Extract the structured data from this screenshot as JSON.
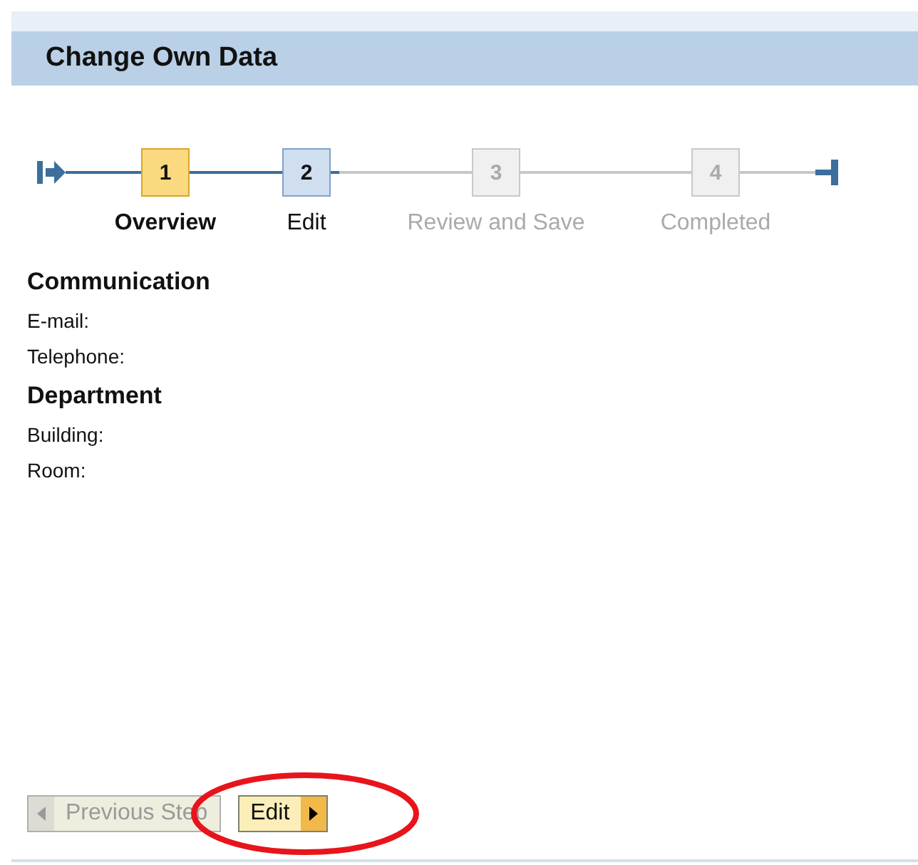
{
  "header": {
    "title": "Change Own Data"
  },
  "steps": [
    {
      "number": "1",
      "label": "Overview",
      "kind": "current"
    },
    {
      "number": "2",
      "label": "Edit",
      "kind": "active"
    },
    {
      "number": "3",
      "label": "Review and Save",
      "kind": "inactive"
    },
    {
      "number": "4",
      "label": "Completed",
      "kind": "inactive"
    }
  ],
  "sections": [
    {
      "title": "Communication",
      "fields": [
        "E-mail:",
        "Telephone:"
      ]
    },
    {
      "title": "Department",
      "fields": [
        "Building:",
        "Room:"
      ]
    }
  ],
  "buttons": [
    {
      "label": "Previous Step",
      "kind": "back",
      "disabled": true
    },
    {
      "label": "Edit",
      "kind": "forward",
      "disabled": false
    }
  ]
}
